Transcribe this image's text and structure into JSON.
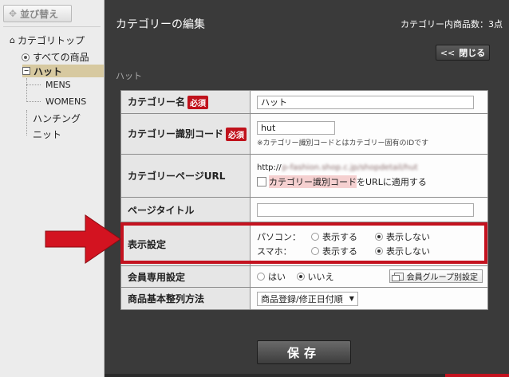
{
  "sidebar": {
    "sort_button": "並び替え",
    "tree": {
      "root": "カテゴリトップ",
      "all_products": "すべての商品",
      "hat": "ハット",
      "mens": "MENS",
      "womens": "WOMENS",
      "hunting": "ハンチング",
      "knit": "ニット"
    }
  },
  "header": {
    "title": "カテゴリーの編集",
    "product_count": "カテゴリー内商品数：3点",
    "close_label": "閉じる",
    "close_chevron": "<<"
  },
  "category_heading": "ハット",
  "form": {
    "required_badge": "必須",
    "category_name": {
      "label": "カテゴリー名",
      "value": "ハット"
    },
    "category_code": {
      "label": "カテゴリー識別コード",
      "value": "hut",
      "hint": "※カテゴリー識別コードとはカテゴリー固有のIDです"
    },
    "category_url": {
      "label": "カテゴリーページURL",
      "prefix": "http://",
      "blurred_url": "p-fashion.shop.c.jp/shopdetail/hut",
      "checkbox_highlight": "カテゴリー識別コード",
      "checkbox_rest": "をURLに適用する"
    },
    "page_title": {
      "label": "ページタイトル",
      "value": ""
    },
    "display_setting": {
      "label": "表示設定",
      "rows": [
        {
          "device": "パソコン：",
          "show": "表示する",
          "hide": "表示しない",
          "selected": "hide"
        },
        {
          "device": "スマホ：",
          "show": "表示する",
          "hide": "表示しない",
          "selected": "hide"
        }
      ]
    },
    "member_only": {
      "label": "会員専用設定",
      "yes": "はい",
      "no": "いいえ",
      "selected": "no",
      "group_button": "会員グループ別設定"
    },
    "sort_method": {
      "label": "商品基本整列方法",
      "value": "商品登録/修正日付順"
    }
  },
  "save_label": "保存",
  "colors": {
    "highlight_red": "#c4121f",
    "panel_dark": "#3a3a3a",
    "selected_tree": "#d7c9a0"
  }
}
